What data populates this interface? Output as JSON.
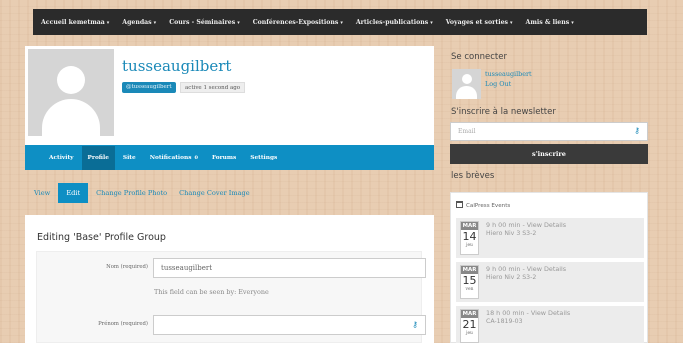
{
  "topnav": {
    "items": [
      {
        "label": "Accueil kemetmaa",
        "caret": "▾"
      },
      {
        "label": "Agendas",
        "caret": "▾"
      },
      {
        "label": "Cours - Séminaires",
        "caret": "▾"
      },
      {
        "label": "Conférences-Expositions",
        "caret": "▾"
      },
      {
        "label": "Articles-publications",
        "caret": "▾"
      },
      {
        "label": "Voyages et sorties",
        "caret": "▾"
      },
      {
        "label": "Amis & liens",
        "caret": "▾"
      }
    ]
  },
  "profile": {
    "username": "tusseaugilbert",
    "handle": "@tusseaugilbert",
    "active": "active 1 second ago"
  },
  "profile_tabs": [
    {
      "label": "Activity"
    },
    {
      "label": "Profile",
      "active": true
    },
    {
      "label": "Site"
    },
    {
      "label": "Notifications",
      "count": "0"
    },
    {
      "label": "Forums"
    },
    {
      "label": "Settings"
    }
  ],
  "subtabs": [
    {
      "label": "View"
    },
    {
      "label": "Edit",
      "active": true
    },
    {
      "label": "Change Profile Photo"
    },
    {
      "label": "Change Cover Image"
    }
  ],
  "edit": {
    "title": "Editing 'Base' Profile Group",
    "fields": [
      {
        "label": "Nom (required)",
        "value": "tusseaugilbert",
        "hint": "This field can be seen by: Everyone"
      },
      {
        "label": "Prénom (required)",
        "value": ""
      }
    ]
  },
  "sidebar": {
    "login_heading": "Se connecter",
    "user_link": "tusseaugilbert",
    "logout": "Log Out",
    "newsletter_heading": "S'inscrire à la newsletter",
    "email_placeholder": "Email",
    "subscribe_label": "s'inscrire",
    "breves_heading": "les brèves",
    "events_source": "CalPress Events",
    "events": [
      {
        "mon": "MAR",
        "day": "14",
        "dow": "jeu",
        "time": "9 h 00 min",
        "details": "View Details",
        "title": "Hiero Niv 3 S3-2"
      },
      {
        "mon": "MAR",
        "day": "15",
        "dow": "ven",
        "time": "9 h 00 min",
        "details": "View Details",
        "title": "Hiero Niv 2 S3-2"
      },
      {
        "mon": "MAR",
        "day": "21",
        "dow": "jeu",
        "time": "18 h 00 min",
        "details": "View Details",
        "title": "CA-1819-03"
      }
    ]
  },
  "colors": {
    "accent": "#0e8fc4",
    "link": "#1a89b8",
    "nav": "#2b2b2b"
  }
}
